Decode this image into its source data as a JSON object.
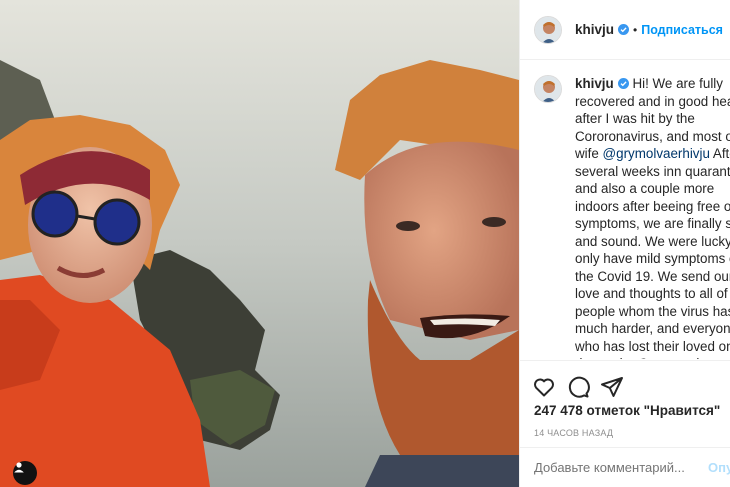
{
  "photo": {
    "alt_icon": "user-tag-icon"
  },
  "header": {
    "username": "khivju",
    "dot": "•",
    "follow_label": "Подписаться"
  },
  "caption": {
    "username": "khivju",
    "text_before_mention": "Hi! We are fully recovered and in good health after I was hit by the Cororonavirus, and most of my wife ",
    "mention": "@grymolvaerhivju",
    "text_after_mention": " After several weeks inn quarantine and also a couple more indoors after beeing free of all symptoms, we are finally safe and sound. We were lucky to only have mild symptoms of the Covid 19. We send our love and thoughts to all of the people whom the virus has hit much harder, and everyone who has lost their loved ones due to the Cornonavirus. Thank you for all of your support, and please remember to stay vigilant and keep your distance, wash your hands and most of all ; take care of each other!"
  },
  "actions": {
    "like_icon": "heart-icon",
    "comment_icon": "comment-icon",
    "share_icon": "share-icon"
  },
  "likes_text": "247 478 отметок \"Нравится\"",
  "time_text": "14 ЧАСОВ НАЗАД",
  "comment_box": {
    "placeholder": "Добавьте комментарий...",
    "post_label": "Опубликовать"
  },
  "colors": {
    "link": "#0095f6",
    "mention": "#00376b",
    "verified": "#3897f0"
  }
}
